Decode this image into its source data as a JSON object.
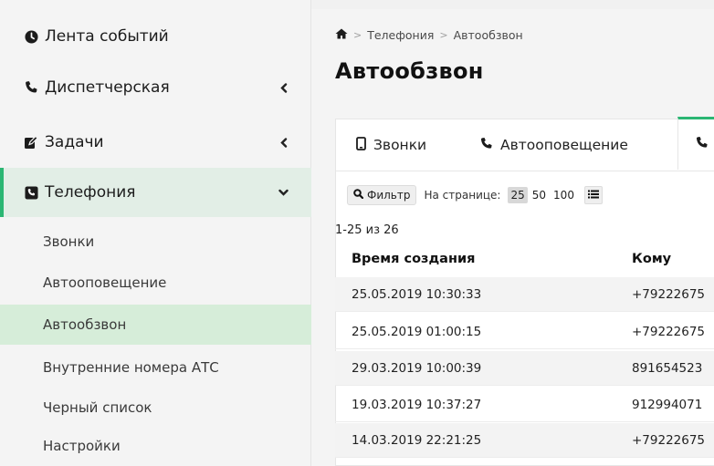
{
  "sidebar": {
    "items": [
      {
        "label": "Лента событий",
        "icon": "clock-icon",
        "has_chevron": false
      },
      {
        "label": "Диспетчерская",
        "icon": "phone-icon",
        "has_chevron": true,
        "chevron": "‹"
      },
      {
        "label": "Задачи",
        "icon": "edit-icon",
        "has_chevron": true,
        "chevron": "‹"
      },
      {
        "label": "Телефония",
        "icon": "phone-square-icon",
        "has_chevron": true,
        "chevron": "⌄",
        "active": true
      }
    ],
    "sub_items": [
      {
        "label": "Звонки"
      },
      {
        "label": "Автооповещение"
      },
      {
        "label": "Автообзвон",
        "selected": true
      },
      {
        "label": "Внутренние номера АТС"
      },
      {
        "label": "Черный список"
      },
      {
        "label": "Настройки"
      }
    ]
  },
  "breadcrumb": {
    "home_icon": "home-icon",
    "sep1": ">",
    "item1": "Телефония",
    "sep2": ">",
    "item2": "Автообзвон"
  },
  "page": {
    "title": "Автообзвон"
  },
  "tabs": [
    {
      "label": "Звонки",
      "icon": "mobile-icon"
    },
    {
      "label": "Автооповещение",
      "icon": "phone-icon"
    },
    {
      "label": "",
      "icon": "phone-icon",
      "active": true
    }
  ],
  "toolbar": {
    "filter_label": "Фильтр",
    "per_page_label": "На странице:",
    "per_page_options": [
      "25",
      "50",
      "100"
    ],
    "per_page_selected": "25"
  },
  "table": {
    "range_text": "1-25 из 26",
    "columns": [
      "Время создания",
      "Кому"
    ],
    "rows": [
      {
        "time": "25.05.2019 10:30:33",
        "to": "+79222675"
      },
      {
        "time": "25.05.2019 01:00:15",
        "to": "+79222675"
      },
      {
        "time": "29.03.2019 10:00:39",
        "to": "891654523"
      },
      {
        "time": "19.03.2019 10:37:27",
        "to": "912994071"
      },
      {
        "time": "14.03.2019 22:21:25",
        "to": "+79222675"
      }
    ]
  },
  "colors": {
    "accent": "#2bb673",
    "selected_bg": "#d6edd9",
    "sidebar_bg": "#f4f4f4"
  }
}
